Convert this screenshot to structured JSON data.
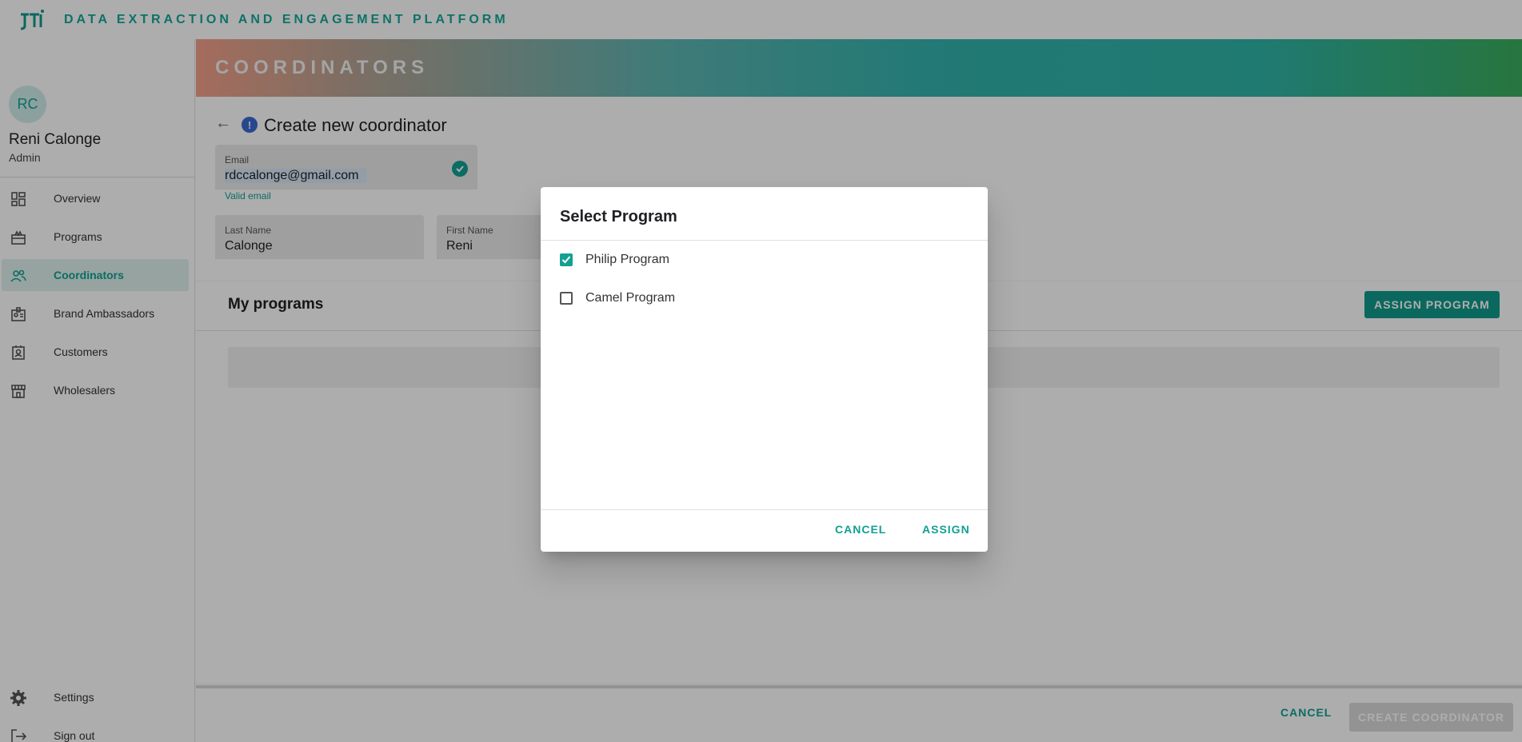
{
  "app": {
    "title": "DATA EXTRACTION AND ENGAGEMENT PLATFORM",
    "logo_icon": "jti-logo-icon"
  },
  "user": {
    "initials": "RC",
    "name": "Reni Calonge",
    "role": "Admin"
  },
  "sidebar": {
    "items": [
      {
        "label": "Overview",
        "icon": "dashboard-icon"
      },
      {
        "label": "Programs",
        "icon": "programs-icon"
      },
      {
        "label": "Coordinators",
        "icon": "people-icon",
        "active": true
      },
      {
        "label": "Brand Ambassadors",
        "icon": "badge-icon"
      },
      {
        "label": "Customers",
        "icon": "contact-card-icon"
      },
      {
        "label": "Wholesalers",
        "icon": "store-icon"
      }
    ],
    "bottom_items": [
      {
        "label": "Settings",
        "icon": "gear-icon"
      },
      {
        "label": "Sign out",
        "icon": "logout-icon"
      }
    ]
  },
  "header": {
    "title": "COORDINATORS"
  },
  "form": {
    "title": "Create new coordinator",
    "email": {
      "label": "Email",
      "value": "rdccalonge@gmail.com",
      "hint": "Valid email"
    },
    "last_name": {
      "label": "Last Name",
      "value": "Calonge"
    },
    "first_name": {
      "label": "First Name",
      "value": "Reni"
    }
  },
  "programs": {
    "title": "My programs",
    "assign_button": "ASSIGN PROGRAM"
  },
  "footer": {
    "cancel": "CANCEL",
    "create": "CREATE COORDINATOR"
  },
  "dialog": {
    "title": "Select Program",
    "options": [
      {
        "label": "Philip Program",
        "checked": true
      },
      {
        "label": "Camel Program",
        "checked": false
      }
    ],
    "cancel": "CANCEL",
    "assign": "ASSIGN"
  },
  "colors": {
    "accent": "#12a093",
    "overlay": "rgba(0,0,0,0.32)"
  }
}
